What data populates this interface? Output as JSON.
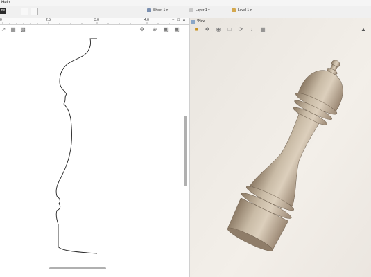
{
  "menu": {
    "help_label": "Help"
  },
  "toolbar": {
    "mode_button_label": "ne",
    "sheet_label": "Sheet 1 ▾",
    "layer_label": "Layer 1 ▾",
    "level_label": "Level 1 ▾"
  },
  "view2d": {
    "ruler_labels": [
      "0",
      "2.5",
      "3.0",
      "4.0"
    ],
    "window_buttons": [
      "−",
      "□",
      "✕"
    ]
  },
  "view3d": {
    "tab_label": "*New"
  },
  "icons": {
    "pan": "move-icon",
    "zoom": "zoom-icon",
    "zoom_fit": "zoom-fit-icon",
    "zoom_box": "zoom-box-icon",
    "shade": "shade-icon"
  },
  "colors": {
    "model_body": "#c6b8a4",
    "model_shadow": "#8c7a65",
    "background_3d": "#efebe6"
  }
}
